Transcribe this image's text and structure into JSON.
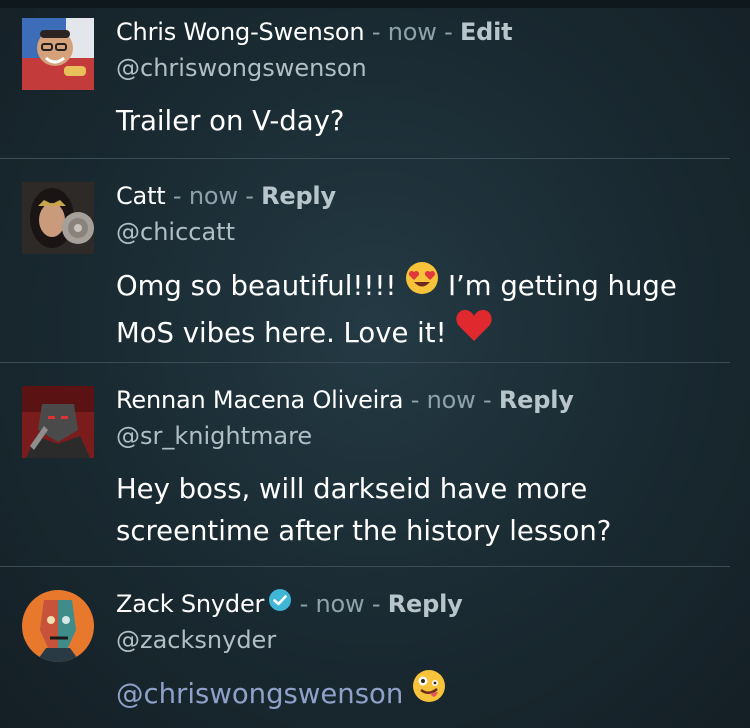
{
  "comments": [
    {
      "name": "Chris Wong-Swenson",
      "separator": " - ",
      "time": "now",
      "separator2": " - ",
      "action": "Edit",
      "handle": "@chriswongswenson",
      "body": "Trailer on V-day?",
      "avatar_icon": "person-portrait-avatar"
    },
    {
      "name": "Catt",
      "separator": " - ",
      "time": "now",
      "separator2": " - ",
      "action": "Reply",
      "handle": "@chiccatt",
      "body_line1_a": "Omg so beautiful!!!! ",
      "body_line1_b": " I’m getting huge",
      "body_line2": "MoS vibes here. Love it! ",
      "avatar_icon": "wonder-woman-avatar"
    },
    {
      "name": "Rennan Macena Oliveira",
      "separator": " - ",
      "time": "now",
      "separator2": " - ",
      "action": "Reply",
      "handle": "@sr_knightmare",
      "body_line1": "Hey boss, will darkseid have more",
      "body_line2": "screentime after the history lesson?",
      "avatar_icon": "darkseid-avatar"
    },
    {
      "name": "Zack Snyder",
      "separator": " - ",
      "time": "now",
      "separator2": " - ",
      "action": "Reply",
      "handle": "@zacksnyder",
      "body_mention": "@chriswongswenson",
      "avatar_icon": "cyborg-face-avatar"
    }
  ],
  "colors": {
    "background": "#1b2c34",
    "muted": "#8ea2ab",
    "action": "#b8c6cc",
    "mention": "#8fa0c9",
    "verified": "#3fb6d6",
    "heart": "#e0282f"
  }
}
